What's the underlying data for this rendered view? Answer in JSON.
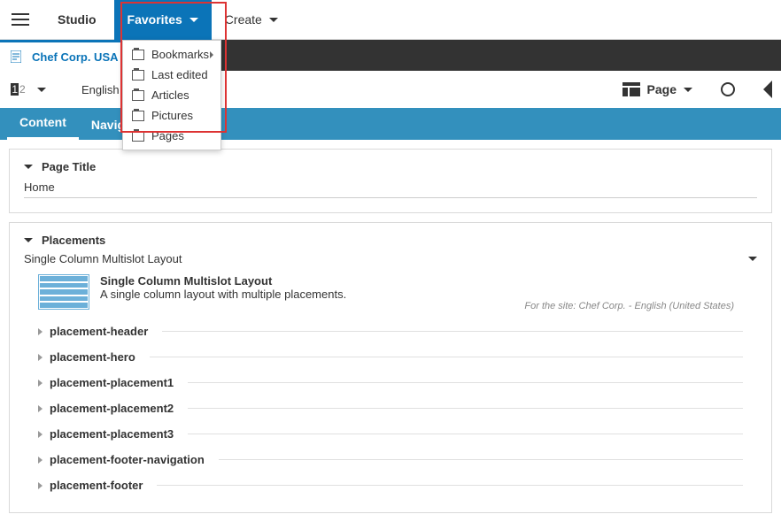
{
  "topbar": {
    "brand": "Studio",
    "favorites": "Favorites",
    "create": "Create"
  },
  "favorites_menu": {
    "bookmarks": "Bookmarks",
    "last_edited": "Last edited",
    "articles": "Articles",
    "pictures": "Pictures",
    "pages": "Pages"
  },
  "open_tab": "Chef Corp. USA Home",
  "language": "English (Uni",
  "page_selector": "Page",
  "tabs": {
    "content": "Content",
    "navigation": "Navigation"
  },
  "page_title_panel": {
    "label": "Page Title",
    "value": "Home"
  },
  "placements_panel": {
    "label": "Placements",
    "layout_name_row": "Single Column Multislot Layout",
    "layout_title": "Single Column Multislot Layout",
    "layout_desc": "A single column layout with multiple placements.",
    "site_note": "For the site: Chef Corp. - English (United States)",
    "items": [
      "placement-header",
      "placement-hero",
      "placement-placement1",
      "placement-placement2",
      "placement-placement3",
      "placement-footer-navigation",
      "placement-footer"
    ]
  }
}
